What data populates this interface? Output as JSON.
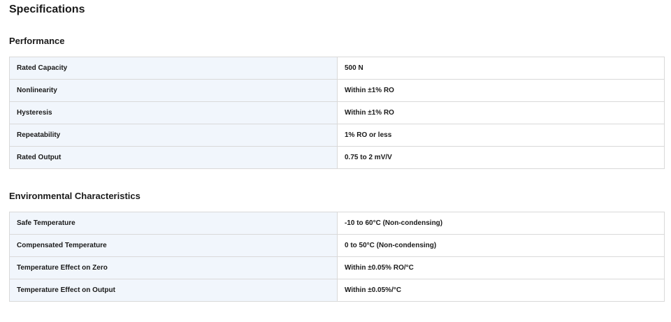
{
  "page_title": "Specifications",
  "sections": [
    {
      "title": "Performance",
      "rows": [
        {
          "label": "Rated Capacity",
          "value": "500 N"
        },
        {
          "label": "Nonlinearity",
          "value": "Within ±1% RO"
        },
        {
          "label": "Hysteresis",
          "value": "Within ±1% RO"
        },
        {
          "label": "Repeatability",
          "value": "1% RO or less"
        },
        {
          "label": "Rated Output",
          "value": "0.75 to 2 mV/V"
        }
      ]
    },
    {
      "title": "Environmental Characteristics",
      "rows": [
        {
          "label": "Safe Temperature",
          "value": "-10 to 60°C (Non-condensing)"
        },
        {
          "label": "Compensated Temperature",
          "value": "0 to 50°C (Non-condensing)"
        },
        {
          "label": "Temperature Effect on Zero",
          "value": "Within ±0.05% RO/°C"
        },
        {
          "label": "Temperature Effect on Output",
          "value": "Within ±0.05%/°C"
        }
      ]
    }
  ],
  "colors": {
    "label_cell_bg": "#f1f6fc",
    "value_cell_bg": "#ffffff",
    "border": "#d9d9d9",
    "text": "#1a1a1a"
  }
}
